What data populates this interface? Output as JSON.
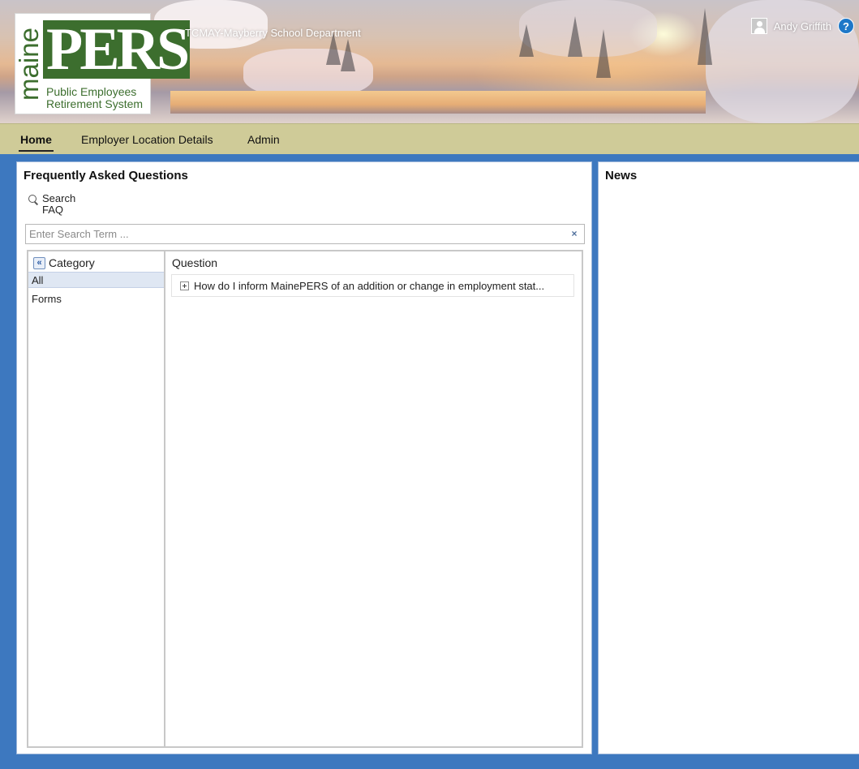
{
  "header": {
    "logo": {
      "word_maine": "maine",
      "word_pers": "PERS",
      "line1": "Public Employees",
      "line2": "Retirement System"
    },
    "organization": "TCMAY-Mayberry School Department",
    "user_name": "Andy Griffith",
    "help_symbol": "?",
    "icons": [
      "user-avatar-icon",
      "help-icon"
    ]
  },
  "nav": {
    "tabs": [
      {
        "label": "Home",
        "active": true
      },
      {
        "label": "Employer Location Details",
        "active": false
      },
      {
        "label": "Admin",
        "active": false
      }
    ]
  },
  "faq": {
    "title": "Frequently Asked Questions",
    "search_link": "Search FAQ",
    "search_placeholder": "Enter Search Term ...",
    "search_value": "",
    "clear_symbol": "×",
    "category_header": "Category",
    "collapse_symbol": "«",
    "categories": [
      {
        "label": "All",
        "selected": true
      },
      {
        "label": "Forms",
        "selected": false
      }
    ],
    "question_header": "Question",
    "questions": [
      {
        "text": "How do I inform MainePERS of an addition or change in employment stat..."
      }
    ]
  },
  "news": {
    "title": "News"
  },
  "colors": {
    "nav_bg": "#cfcb98",
    "frame_blue": "#3d78bf",
    "logo_green": "#3c6e2e",
    "selected_row": "#dfe7f3"
  }
}
